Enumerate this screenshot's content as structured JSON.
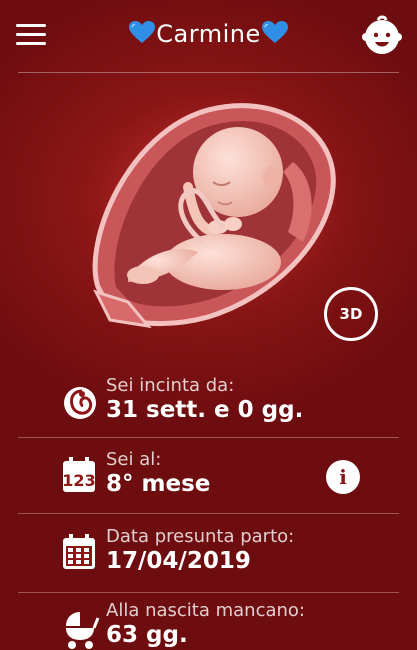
{
  "header": {
    "title": "Carmine",
    "icons": {
      "menu": "hamburger-menu-icon",
      "heart": "blue-heart-icon",
      "baby": "baby-face-icon"
    }
  },
  "hero": {
    "button_3d_label": "3D"
  },
  "stats": [
    {
      "label": "Sei incinta da:",
      "value": "31 sett. e 0 gg.",
      "icon": "pregnancy-icon"
    },
    {
      "label": "Sei al:",
      "value": "8° mese",
      "icon": "month-number-icon"
    },
    {
      "label": "Data presunta parto:",
      "value": "17/04/2019",
      "icon": "calendar-icon"
    },
    {
      "label": "Alla nascita mancano:",
      "value": "63 gg.",
      "icon": "stroller-icon"
    }
  ],
  "colors": {
    "background": "#8c1616",
    "heart": "#2f8fe6",
    "accent_white": "#ffffff"
  }
}
